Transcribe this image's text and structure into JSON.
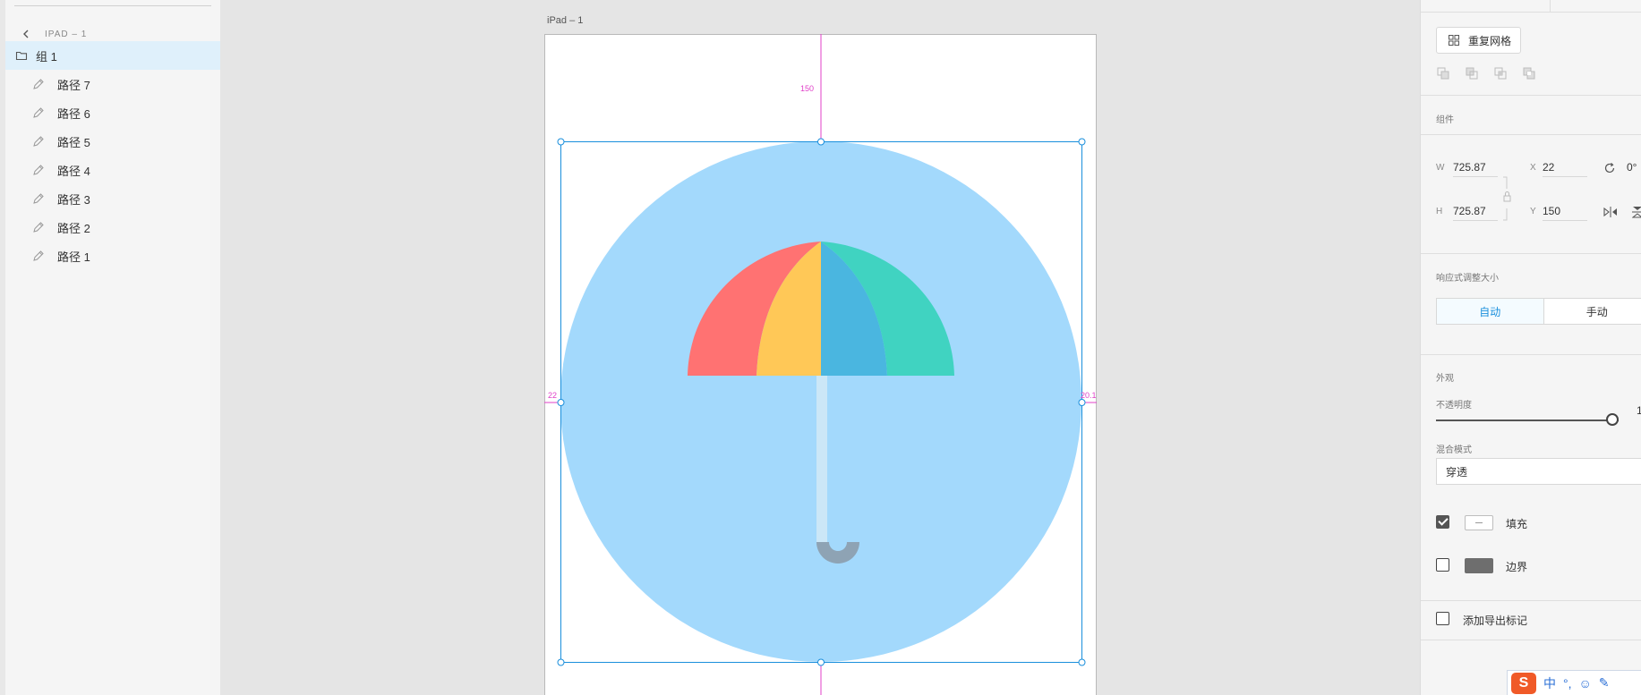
{
  "layers": {
    "breadcrumb": "IPAD – 1",
    "group": {
      "label": "组 1"
    },
    "children": [
      {
        "label": "路径 7"
      },
      {
        "label": "路径 6"
      },
      {
        "label": "路径 5"
      },
      {
        "label": "路径 4"
      },
      {
        "label": "路径 3"
      },
      {
        "label": "路径 2"
      },
      {
        "label": "路径 1"
      }
    ]
  },
  "canvas": {
    "artboard_label": "iPad – 1",
    "guides": {
      "top": "150",
      "left": "22",
      "right": "20.1"
    },
    "colors": {
      "circle": "#a3d9fc",
      "red": "#ff7272",
      "yellow": "#ffc857",
      "blue": "#4ab6e0",
      "teal": "#40d3c1",
      "shaft": "#cbe7f7",
      "handle": "#8ea3b4",
      "selection": "#1a8fdc",
      "guide": "#e040c8"
    }
  },
  "props": {
    "repeat_grid": "重复网格",
    "component_title": "组件",
    "w_label": "W",
    "w_value": "725.87",
    "x_label": "X",
    "x_value": "22",
    "h_label": "H",
    "h_value": "725.87",
    "y_label": "Y",
    "y_value": "150",
    "rotation": "0°",
    "responsive_title": "响应式调整大小",
    "responsive_auto": "自动",
    "responsive_manual": "手动",
    "appearance_title": "外观",
    "opacity_label": "不透明度",
    "opacity_value": "1",
    "blend_label": "混合模式",
    "blend_value": "穿透",
    "fill_label": "填充",
    "fill_checked": true,
    "border_label": "边界",
    "border_checked": false,
    "export_label": "添加导出标记",
    "export_checked": false
  },
  "ime": {
    "logo": "S",
    "items": [
      "中",
      "°,",
      "☺",
      "✎"
    ]
  }
}
